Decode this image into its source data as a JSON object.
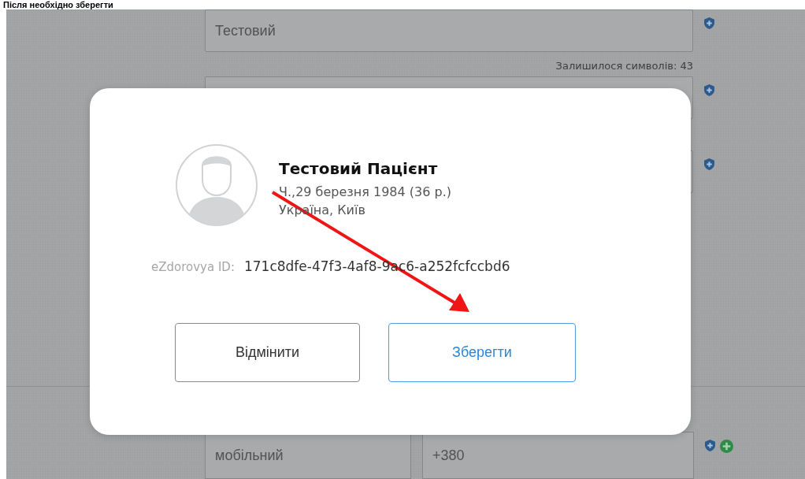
{
  "heading": "Після необхідно зберегти",
  "form": {
    "name_field": {
      "value": "Тестовий"
    },
    "char_counter": "Залишилося символів: 43",
    "phone": {
      "type": "мобільний",
      "number": "+380"
    }
  },
  "dialog": {
    "name": "Тестовий Пацієнт",
    "birth": "Ч.,29 березня 1984 (36 р.)",
    "location": "Україна, Київ",
    "id_label": "eZdorovya ID:",
    "id_value": "171c8dfe-47f3-4af8-9ac6-a252fcfccbd6",
    "buttons": [
      {
        "label": "Відмінити",
        "kind": "cancel"
      },
      {
        "label": "Зберегти",
        "kind": "primary"
      }
    ]
  }
}
